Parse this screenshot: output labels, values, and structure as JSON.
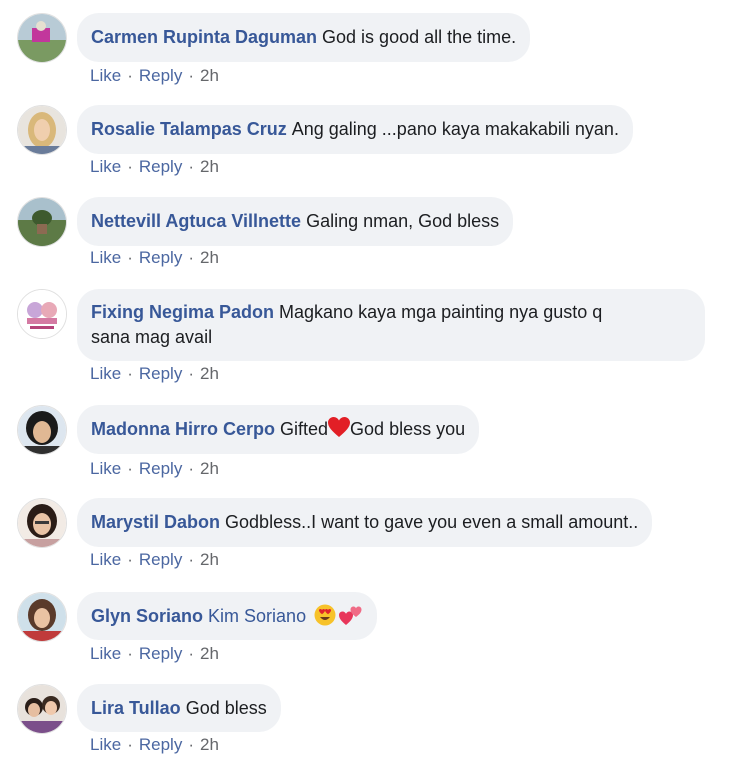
{
  "comments": [
    {
      "author": "Carmen Rupinta Daguman",
      "text": "God is good all the time.",
      "like": "Like",
      "reply": "Reply",
      "time": "2h",
      "avatar": "avatar-landscape-pink"
    },
    {
      "author": "Rosalie Talampas Cruz",
      "text": "Ang galing ...pano kaya makakabili nyan.",
      "like": "Like",
      "reply": "Reply",
      "time": "2h",
      "avatar": "avatar-woman-blonde"
    },
    {
      "author": "Nettevill Agtuca Villnette",
      "text": "Galing nman, God bless",
      "like": "Like",
      "reply": "Reply",
      "time": "2h",
      "avatar": "avatar-landscape-green"
    },
    {
      "author": "Fixing Negima Padon",
      "text_line1": "Magkano kaya mga painting nya gusto q",
      "text_line2": "sana mag avail",
      "like": "Like",
      "reply": "Reply",
      "time": "2h",
      "avatar": "avatar-cartoon-logo"
    },
    {
      "author": "Madonna Hirro Cerpo",
      "text_before": "Gifted",
      "text_after": "God bless you",
      "like": "Like",
      "reply": "Reply",
      "time": "2h",
      "avatar": "avatar-woman-dark-hair",
      "emoji": "red-heart-icon"
    },
    {
      "author": "Marystil Dabon",
      "text": "Godbless..I want to gave you even a small amount..",
      "like": "Like",
      "reply": "Reply",
      "time": "2h",
      "avatar": "avatar-woman-glasses"
    },
    {
      "author": "Glyn Soriano",
      "mention": "Kim Soriano",
      "like": "Like",
      "reply": "Reply",
      "time": "2h",
      "avatar": "avatar-woman-red",
      "emoji": [
        "heart-eyes-emoji-icon",
        "two-hearts-emoji-icon"
      ]
    },
    {
      "author": "Lira Tullao",
      "text": "God bless",
      "like": "Like",
      "reply": "Reply",
      "time": "2h",
      "avatar": "avatar-couple"
    }
  ],
  "colors": {
    "author": "#385898",
    "bubble": "#f0f2f5",
    "meta": "#65676b"
  }
}
